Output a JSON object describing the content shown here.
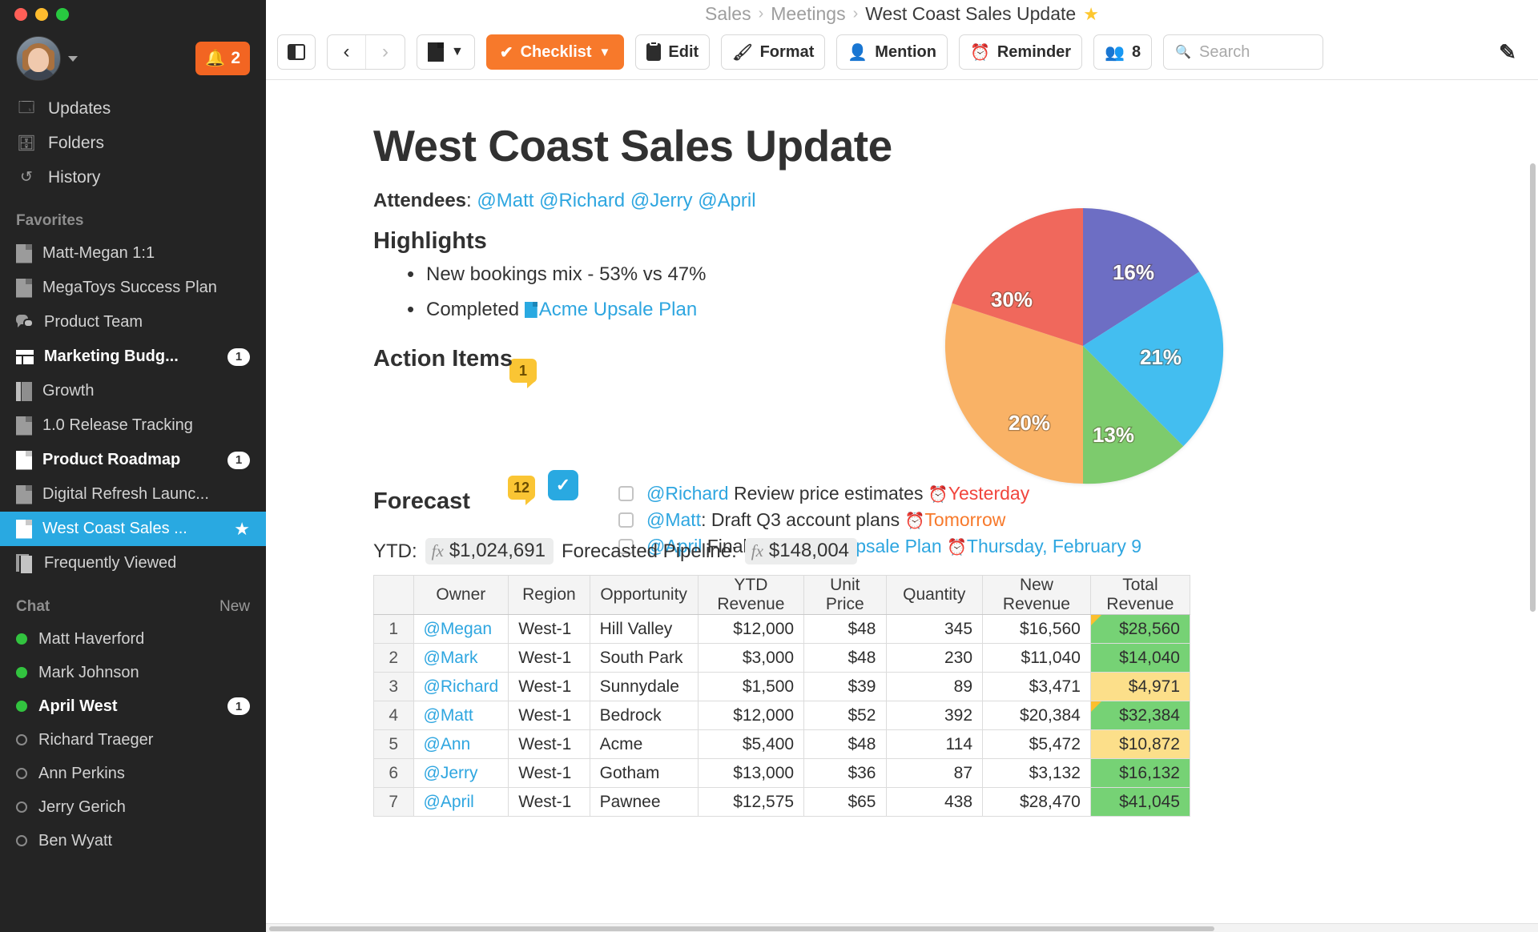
{
  "window": {
    "traffic_lights": [
      "close",
      "minimize",
      "maximize"
    ]
  },
  "sidebar": {
    "user": {
      "avatar_alt": "user-avatar",
      "chevron": "▾"
    },
    "notifications": {
      "icon": "bell-icon",
      "count": "2"
    },
    "nav": [
      {
        "label": "Updates",
        "icon": "updates-icon"
      },
      {
        "label": "Folders",
        "icon": "folders-icon"
      },
      {
        "label": "History",
        "icon": "history-icon"
      }
    ],
    "favorites_label": "Favorites",
    "favorites": [
      {
        "label": "Matt-Megan 1:1",
        "icon": "doc-icon",
        "bold": false,
        "badge": "",
        "starred": false,
        "active": false
      },
      {
        "label": "MegaToys Success Plan",
        "icon": "doc-icon",
        "bold": false,
        "badge": "",
        "starred": false,
        "active": false
      },
      {
        "label": "Product Team",
        "icon": "chat-icon",
        "bold": false,
        "badge": "",
        "starred": false,
        "active": false
      },
      {
        "label": "Marketing Budg...",
        "icon": "board-icon",
        "bold": true,
        "badge": "1",
        "starred": false,
        "active": false
      },
      {
        "label": "Growth",
        "icon": "column-icon",
        "bold": false,
        "badge": "",
        "starred": false,
        "active": false
      },
      {
        "label": "1.0 Release Tracking",
        "icon": "doc-icon",
        "bold": false,
        "badge": "",
        "starred": false,
        "active": false
      },
      {
        "label": "Product Roadmap",
        "icon": "doc-icon",
        "bold": true,
        "badge": "1",
        "starred": false,
        "active": false
      },
      {
        "label": "Digital Refresh Launc...",
        "icon": "doc-icon",
        "bold": false,
        "badge": "",
        "starred": false,
        "active": false
      },
      {
        "label": "West Coast Sales ...",
        "icon": "doc-icon",
        "bold": false,
        "badge": "",
        "starred": true,
        "active": true
      },
      {
        "label": "Frequently Viewed",
        "icon": "stack-icon",
        "bold": false,
        "badge": "",
        "starred": false,
        "active": false
      }
    ],
    "chat_label": "Chat",
    "chat_new_label": "New",
    "chat": [
      {
        "name": "Matt Haverford",
        "status": "online",
        "badge": "",
        "bold": false
      },
      {
        "name": "Mark Johnson",
        "status": "online",
        "badge": "",
        "bold": false
      },
      {
        "name": "April West",
        "status": "online",
        "badge": "1",
        "bold": true
      },
      {
        "name": "Richard Traeger",
        "status": "offline",
        "badge": "",
        "bold": false
      },
      {
        "name": "Ann Perkins",
        "status": "offline",
        "badge": "",
        "bold": false
      },
      {
        "name": "Jerry Gerich",
        "status": "offline",
        "badge": "",
        "bold": false
      },
      {
        "name": "Ben Wyatt",
        "status": "offline",
        "badge": "",
        "bold": false
      }
    ]
  },
  "breadcrumb": {
    "root": "Sales",
    "sep": "›",
    "parent": "Meetings",
    "current": "West Coast Sales Update",
    "star": "★"
  },
  "toolbar": {
    "sidebar_toggle": "sidebar-toggle",
    "back": "‹",
    "forward": "›",
    "doc_menu_caret": "⌄",
    "checklist_label": "Checklist",
    "checklist_caret": "⌄",
    "edit_label": "Edit",
    "format_label": "Format",
    "mention_label": "Mention",
    "reminder_label": "Reminder",
    "people_count": "8",
    "search_placeholder": "Search",
    "compose": "compose-icon"
  },
  "document": {
    "title": "West Coast Sales Update",
    "attendees_label": "Attendees",
    "attendees": [
      "@Matt",
      "@Richard",
      "@Jerry",
      "@April"
    ],
    "highlights_heading": "Highlights",
    "highlights": [
      {
        "text": "New bookings mix - 53% vs 47%",
        "link": ""
      },
      {
        "text": "Completed ",
        "link": "Acme Upsale Plan"
      }
    ],
    "highlights_comment_count": "1",
    "action_heading": "Action Items",
    "action_comment_count": "12",
    "action_check_icon": "checked-box-icon",
    "action_items": [
      {
        "checked": false,
        "owner": "@Richard",
        "text": " Review price estimates ",
        "due": "Yesterday",
        "due_color": "red"
      },
      {
        "checked": false,
        "owner": "@Matt",
        "text": ": Draft Q3 account plans ",
        "due": "Tomorrow",
        "due_color": "orange"
      },
      {
        "checked": false,
        "owner": "@April",
        "text": " Finalize ",
        "link": "Acme Upsale Plan",
        "due": "Thursday, February 9",
        "due_color": "blue"
      }
    ],
    "forecast_heading": "Forecast",
    "ytd_label": "YTD:",
    "ytd_value": "$1,024,691",
    "pipeline_label": "Forecasted Pipeline:",
    "pipeline_value": "$148,004",
    "fx_symbol": "fx"
  },
  "table": {
    "columns": [
      "",
      "Owner",
      "Region",
      "Opportunity",
      "YTD Revenue",
      "Unit Price",
      "Quantity",
      "New Revenue",
      "Total Revenue"
    ],
    "rows": [
      {
        "n": "1",
        "owner": "@Megan",
        "region": "West-1",
        "opportunity": "Hill Valley",
        "ytd": "$12,000",
        "unit": "$48",
        "qty": "345",
        "newrev": "$16,560",
        "total": "$28,560",
        "total_fill": "green",
        "flag": true
      },
      {
        "n": "2",
        "owner": "@Mark",
        "region": "West-1",
        "opportunity": "South Park",
        "ytd": "$3,000",
        "unit": "$48",
        "qty": "230",
        "newrev": "$11,040",
        "total": "$14,040",
        "total_fill": "green",
        "flag": false
      },
      {
        "n": "3",
        "owner": "@Richard",
        "region": "West-1",
        "opportunity": "Sunnydale",
        "ytd": "$1,500",
        "unit": "$39",
        "qty": "89",
        "newrev": "$3,471",
        "total": "$4,971",
        "total_fill": "yellow",
        "flag": false
      },
      {
        "n": "4",
        "owner": "@Matt",
        "region": "West-1",
        "opportunity": "Bedrock",
        "ytd": "$12,000",
        "unit": "$52",
        "qty": "392",
        "newrev": "$20,384",
        "total": "$32,384",
        "total_fill": "green",
        "flag": true
      },
      {
        "n": "5",
        "owner": "@Ann",
        "region": "West-1",
        "opportunity": "Acme",
        "ytd": "$5,400",
        "unit": "$48",
        "qty": "114",
        "newrev": "$5,472",
        "total": "$10,872",
        "total_fill": "yellow",
        "flag": false
      },
      {
        "n": "6",
        "owner": "@Jerry",
        "region": "West-1",
        "opportunity": "Gotham",
        "ytd": "$13,000",
        "unit": "$36",
        "qty": "87",
        "newrev": "$3,132",
        "total": "$16,132",
        "total_fill": "green",
        "flag": false
      },
      {
        "n": "7",
        "owner": "@April",
        "region": "West-1",
        "opportunity": "Pawnee",
        "ytd": "$12,575",
        "unit": "$65",
        "qty": "438",
        "newrev": "$28,470",
        "total": "$41,045",
        "total_fill": "green",
        "flag": false
      }
    ]
  },
  "chart_data": {
    "type": "pie",
    "title": "",
    "labels": [
      "16%",
      "21%",
      "13%",
      "20%",
      "30%"
    ],
    "values": [
      16,
      21,
      13,
      20,
      30
    ],
    "colors": [
      "#6d6ec4",
      "#43bef0",
      "#7dcb6d",
      "#f9b266",
      "#f0685c"
    ],
    "legend": "none",
    "start_angle_deg": 0,
    "direction": "clockwise"
  }
}
